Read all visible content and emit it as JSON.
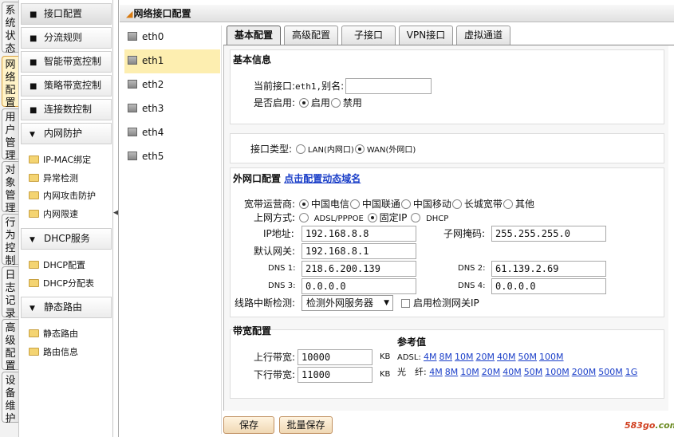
{
  "side_tabs": [
    "系统状态",
    "网络配置",
    "用户管理",
    "对象管理",
    "行为控制",
    "日志记录",
    "高级配置",
    "设备维护"
  ],
  "menu": {
    "items": [
      "接口配置",
      "分流规则",
      "智能带宽控制",
      "策略带宽控制",
      "连接数控制"
    ],
    "groups": [
      {
        "label": "内网防护",
        "children": [
          "IP-MAC绑定",
          "异常检测",
          "内网攻击防护",
          "内网限速"
        ]
      },
      {
        "label": "DHCP服务",
        "children": [
          "DHCP配置",
          "DHCP分配表"
        ]
      },
      {
        "label": "静态路由",
        "children": [
          "静态路由",
          "路由信息"
        ]
      }
    ]
  },
  "page_title": "网络接口配置",
  "interfaces": [
    "eth0",
    "eth1",
    "eth2",
    "eth3",
    "eth4",
    "eth5"
  ],
  "tabs": [
    "基本配置",
    "高级配置",
    "子接口",
    "VPN接口",
    "虚拟通道"
  ],
  "basic": {
    "legend": "基本信息",
    "current_label": "当前接口:",
    "current_value": "eth1,",
    "alias_label": "别名:",
    "alias_value": "",
    "enable_label": "是否启用:",
    "enable_on": "启用",
    "enable_off": "禁用"
  },
  "iface_type": {
    "label": "接口类型:",
    "lan": "LAN(内网口)",
    "wan": "WAN(外网口)"
  },
  "wan": {
    "legend": "外网口配置",
    "ddns_link": "点击配置动态域名",
    "isp_label": "宽带运营商:",
    "isps": [
      "中国电信",
      "中国联通",
      "中国移动",
      "长城宽带",
      "其他"
    ],
    "mode_label": "上网方式:",
    "modes": [
      "ADSL/PPPOE",
      "固定IP",
      "DHCP"
    ],
    "ip_label": "IP地址:",
    "ip": "192.168.8.8",
    "mask_label": "子网掩码:",
    "mask": "255.255.255.0",
    "gw_label": "默认网关:",
    "gw": "192.168.8.1",
    "dns1_label": "DNS 1:",
    "dns1": "218.6.200.139",
    "dns2_label": "DNS 2:",
    "dns2": "61.139.2.69",
    "dns3_label": "DNS 3:",
    "dns3": "0.0.0.0",
    "dns4_label": "DNS 4:",
    "dns4": "0.0.0.0",
    "detect_label": "线路中断检测:",
    "detect_value": "检测外网服务器",
    "gateway_check": "启用检测网关IP"
  },
  "bandwidth": {
    "legend": "带宽配置",
    "up_label": "上行带宽:",
    "up": "10000",
    "down_label": "下行带宽:",
    "down": "11000",
    "unit": "KB",
    "ref_title": "参考值",
    "adsl_label": "ADSL:",
    "adsl": [
      "4M",
      "8M",
      "10M",
      "20M",
      "40M",
      "50M",
      "100M"
    ],
    "fiber_label": "光　纤:",
    "fiber": [
      "4M",
      "8M",
      "10M",
      "20M",
      "40M",
      "50M",
      "100M",
      "200M",
      "500M",
      "1G"
    ]
  },
  "buttons": {
    "save": "保存",
    "batch_save": "批量保存"
  },
  "watermark": {
    "prefix": "583go",
    "suffix": ".com"
  }
}
